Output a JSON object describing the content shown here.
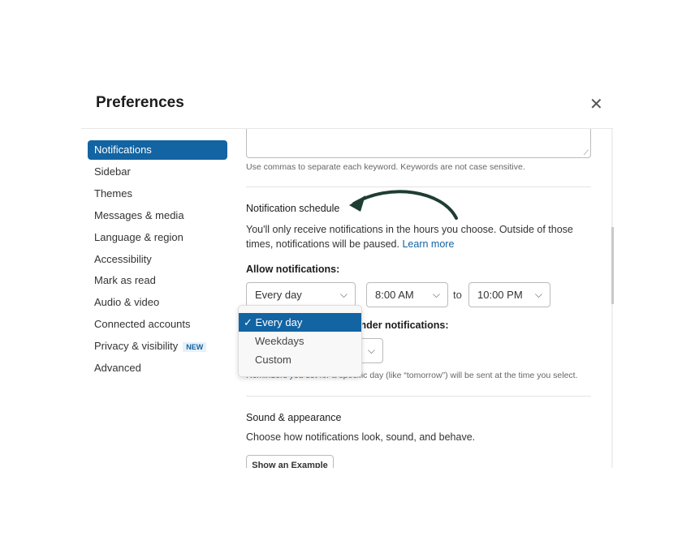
{
  "title": "Preferences",
  "sidebar": {
    "items": [
      {
        "label": "Notifications",
        "active": true
      },
      {
        "label": "Sidebar"
      },
      {
        "label": "Themes"
      },
      {
        "label": "Messages & media"
      },
      {
        "label": "Language & region"
      },
      {
        "label": "Accessibility"
      },
      {
        "label": "Mark as read"
      },
      {
        "label": "Audio & video"
      },
      {
        "label": "Connected accounts"
      },
      {
        "label": "Privacy & visibility",
        "badge": "NEW"
      },
      {
        "label": "Advanced"
      }
    ]
  },
  "keywords": {
    "hint": "Use commas to separate each keyword. Keywords are not case sensitive."
  },
  "schedule": {
    "heading": "Notification schedule",
    "desc": "You'll only receive notifications in the hours you choose. Outside of those times, notifications will be paused.",
    "learn_more": "Learn more",
    "allow_label": "Allow notifications:",
    "days": "Every day",
    "from": "8:00 AM",
    "to_label": "to",
    "to": "10:00 PM"
  },
  "reminder": {
    "label_partial": "inder notifications:",
    "hint_partial": "for a specific day (like “tomorrow”) will be sent at the time you select.",
    "hint_hidden": "Reminders you set"
  },
  "dropdown": {
    "options": [
      "Every day",
      "Weekdays",
      "Custom"
    ],
    "selected": "Every day"
  },
  "sound": {
    "heading": "Sound & appearance",
    "desc": "Choose how notifications look, sound, and behave.",
    "button": "Show an Example"
  },
  "colors": {
    "accent": "#1264a3",
    "arrow": "#1f3d33"
  }
}
